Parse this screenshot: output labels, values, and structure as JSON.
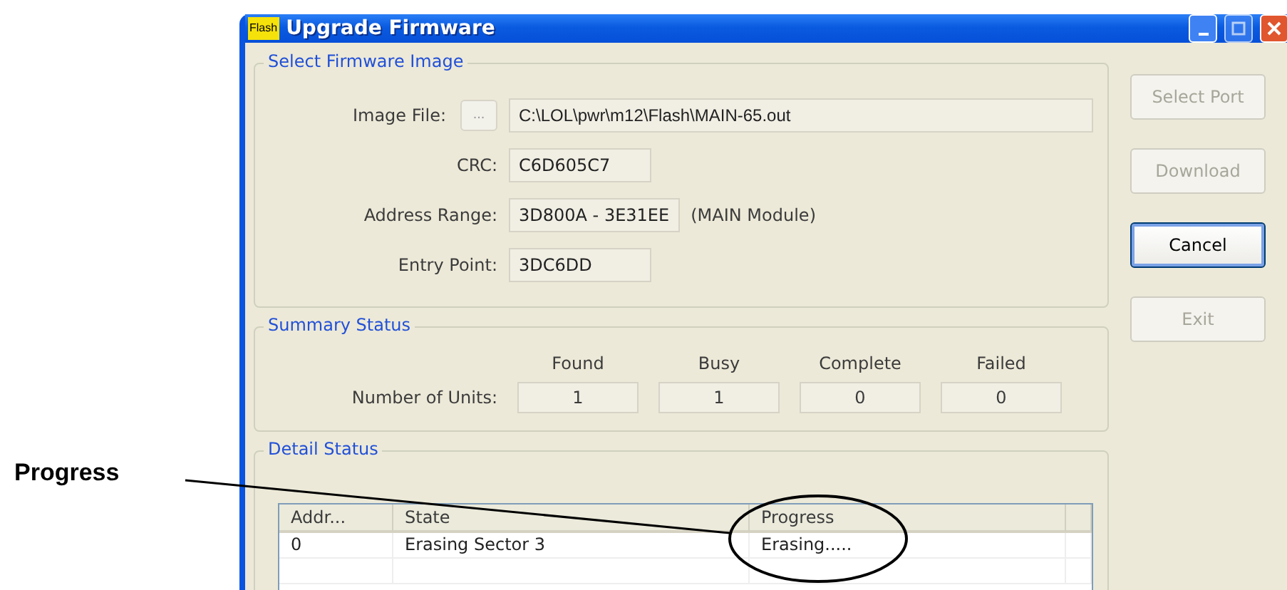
{
  "annotation": {
    "label": "Progress"
  },
  "window": {
    "title": "Upgrade Firmware",
    "icon_text": "Flash"
  },
  "firmware_group": {
    "title": "Select Firmware Image",
    "fields": [
      {
        "label": "Image File:",
        "browse": "...",
        "value": "C:\\LOL\\pwr\\m12\\Flash\\MAIN-65.out"
      },
      {
        "label": "CRC:",
        "value": "C6D605C7"
      },
      {
        "label": "Address Range:",
        "value": "3D800A - 3E31EE",
        "note": "(MAIN Module)"
      },
      {
        "label": "Entry Point:",
        "value": "3DC6DD"
      }
    ]
  },
  "summary_group": {
    "title": "Summary Status",
    "columns": [
      "Found",
      "Busy",
      "Complete",
      "Failed"
    ],
    "row_label": "Number of Units:",
    "values": [
      "1",
      "1",
      "0",
      "0"
    ]
  },
  "detail_group": {
    "title": "Detail Status",
    "table": {
      "columns": [
        "Addr...",
        "State",
        "Progress"
      ],
      "rows": [
        [
          "0",
          "Erasing Sector 3",
          "Erasing....."
        ]
      ]
    }
  },
  "buttons": [
    {
      "label": "Select Port",
      "disabled": true,
      "focused": false
    },
    {
      "label": "Download",
      "disabled": true,
      "focused": false
    },
    {
      "label": "Cancel",
      "disabled": false,
      "focused": true
    },
    {
      "label": "Exit",
      "disabled": true,
      "focused": false
    }
  ]
}
